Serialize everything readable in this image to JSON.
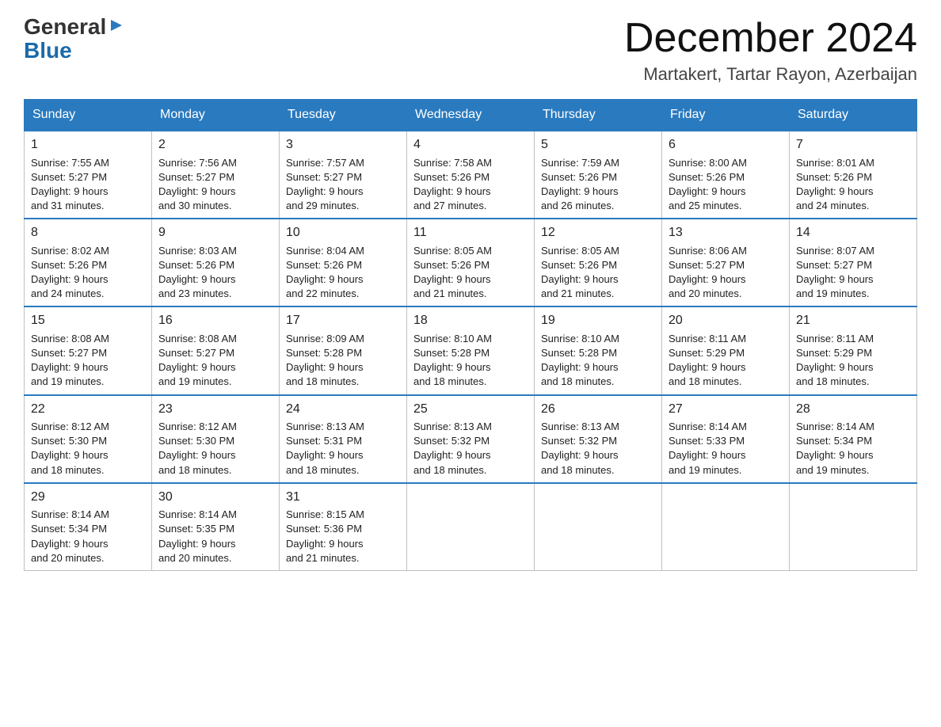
{
  "logo": {
    "general": "General",
    "blue": "Blue"
  },
  "title": {
    "month": "December 2024",
    "location": "Martakert, Tartar Rayon, Azerbaijan"
  },
  "headers": [
    "Sunday",
    "Monday",
    "Tuesday",
    "Wednesday",
    "Thursday",
    "Friday",
    "Saturday"
  ],
  "weeks": [
    [
      {
        "day": "1",
        "sunrise": "7:55 AM",
        "sunset": "5:27 PM",
        "daylight": "9 hours and 31 minutes."
      },
      {
        "day": "2",
        "sunrise": "7:56 AM",
        "sunset": "5:27 PM",
        "daylight": "9 hours and 30 minutes."
      },
      {
        "day": "3",
        "sunrise": "7:57 AM",
        "sunset": "5:27 PM",
        "daylight": "9 hours and 29 minutes."
      },
      {
        "day": "4",
        "sunrise": "7:58 AM",
        "sunset": "5:26 PM",
        "daylight": "9 hours and 27 minutes."
      },
      {
        "day": "5",
        "sunrise": "7:59 AM",
        "sunset": "5:26 PM",
        "daylight": "9 hours and 26 minutes."
      },
      {
        "day": "6",
        "sunrise": "8:00 AM",
        "sunset": "5:26 PM",
        "daylight": "9 hours and 25 minutes."
      },
      {
        "day": "7",
        "sunrise": "8:01 AM",
        "sunset": "5:26 PM",
        "daylight": "9 hours and 24 minutes."
      }
    ],
    [
      {
        "day": "8",
        "sunrise": "8:02 AM",
        "sunset": "5:26 PM",
        "daylight": "9 hours and 24 minutes."
      },
      {
        "day": "9",
        "sunrise": "8:03 AM",
        "sunset": "5:26 PM",
        "daylight": "9 hours and 23 minutes."
      },
      {
        "day": "10",
        "sunrise": "8:04 AM",
        "sunset": "5:26 PM",
        "daylight": "9 hours and 22 minutes."
      },
      {
        "day": "11",
        "sunrise": "8:05 AM",
        "sunset": "5:26 PM",
        "daylight": "9 hours and 21 minutes."
      },
      {
        "day": "12",
        "sunrise": "8:05 AM",
        "sunset": "5:26 PM",
        "daylight": "9 hours and 21 minutes."
      },
      {
        "day": "13",
        "sunrise": "8:06 AM",
        "sunset": "5:27 PM",
        "daylight": "9 hours and 20 minutes."
      },
      {
        "day": "14",
        "sunrise": "8:07 AM",
        "sunset": "5:27 PM",
        "daylight": "9 hours and 19 minutes."
      }
    ],
    [
      {
        "day": "15",
        "sunrise": "8:08 AM",
        "sunset": "5:27 PM",
        "daylight": "9 hours and 19 minutes."
      },
      {
        "day": "16",
        "sunrise": "8:08 AM",
        "sunset": "5:27 PM",
        "daylight": "9 hours and 19 minutes."
      },
      {
        "day": "17",
        "sunrise": "8:09 AM",
        "sunset": "5:28 PM",
        "daylight": "9 hours and 18 minutes."
      },
      {
        "day": "18",
        "sunrise": "8:10 AM",
        "sunset": "5:28 PM",
        "daylight": "9 hours and 18 minutes."
      },
      {
        "day": "19",
        "sunrise": "8:10 AM",
        "sunset": "5:28 PM",
        "daylight": "9 hours and 18 minutes."
      },
      {
        "day": "20",
        "sunrise": "8:11 AM",
        "sunset": "5:29 PM",
        "daylight": "9 hours and 18 minutes."
      },
      {
        "day": "21",
        "sunrise": "8:11 AM",
        "sunset": "5:29 PM",
        "daylight": "9 hours and 18 minutes."
      }
    ],
    [
      {
        "day": "22",
        "sunrise": "8:12 AM",
        "sunset": "5:30 PM",
        "daylight": "9 hours and 18 minutes."
      },
      {
        "day": "23",
        "sunrise": "8:12 AM",
        "sunset": "5:30 PM",
        "daylight": "9 hours and 18 minutes."
      },
      {
        "day": "24",
        "sunrise": "8:13 AM",
        "sunset": "5:31 PM",
        "daylight": "9 hours and 18 minutes."
      },
      {
        "day": "25",
        "sunrise": "8:13 AM",
        "sunset": "5:32 PM",
        "daylight": "9 hours and 18 minutes."
      },
      {
        "day": "26",
        "sunrise": "8:13 AM",
        "sunset": "5:32 PM",
        "daylight": "9 hours and 18 minutes."
      },
      {
        "day": "27",
        "sunrise": "8:14 AM",
        "sunset": "5:33 PM",
        "daylight": "9 hours and 19 minutes."
      },
      {
        "day": "28",
        "sunrise": "8:14 AM",
        "sunset": "5:34 PM",
        "daylight": "9 hours and 19 minutes."
      }
    ],
    [
      {
        "day": "29",
        "sunrise": "8:14 AM",
        "sunset": "5:34 PM",
        "daylight": "9 hours and 20 minutes."
      },
      {
        "day": "30",
        "sunrise": "8:14 AM",
        "sunset": "5:35 PM",
        "daylight": "9 hours and 20 minutes."
      },
      {
        "day": "31",
        "sunrise": "8:15 AM",
        "sunset": "5:36 PM",
        "daylight": "9 hours and 21 minutes."
      },
      null,
      null,
      null,
      null
    ]
  ],
  "labels": {
    "sunrise": "Sunrise:",
    "sunset": "Sunset:",
    "daylight": "Daylight:"
  }
}
